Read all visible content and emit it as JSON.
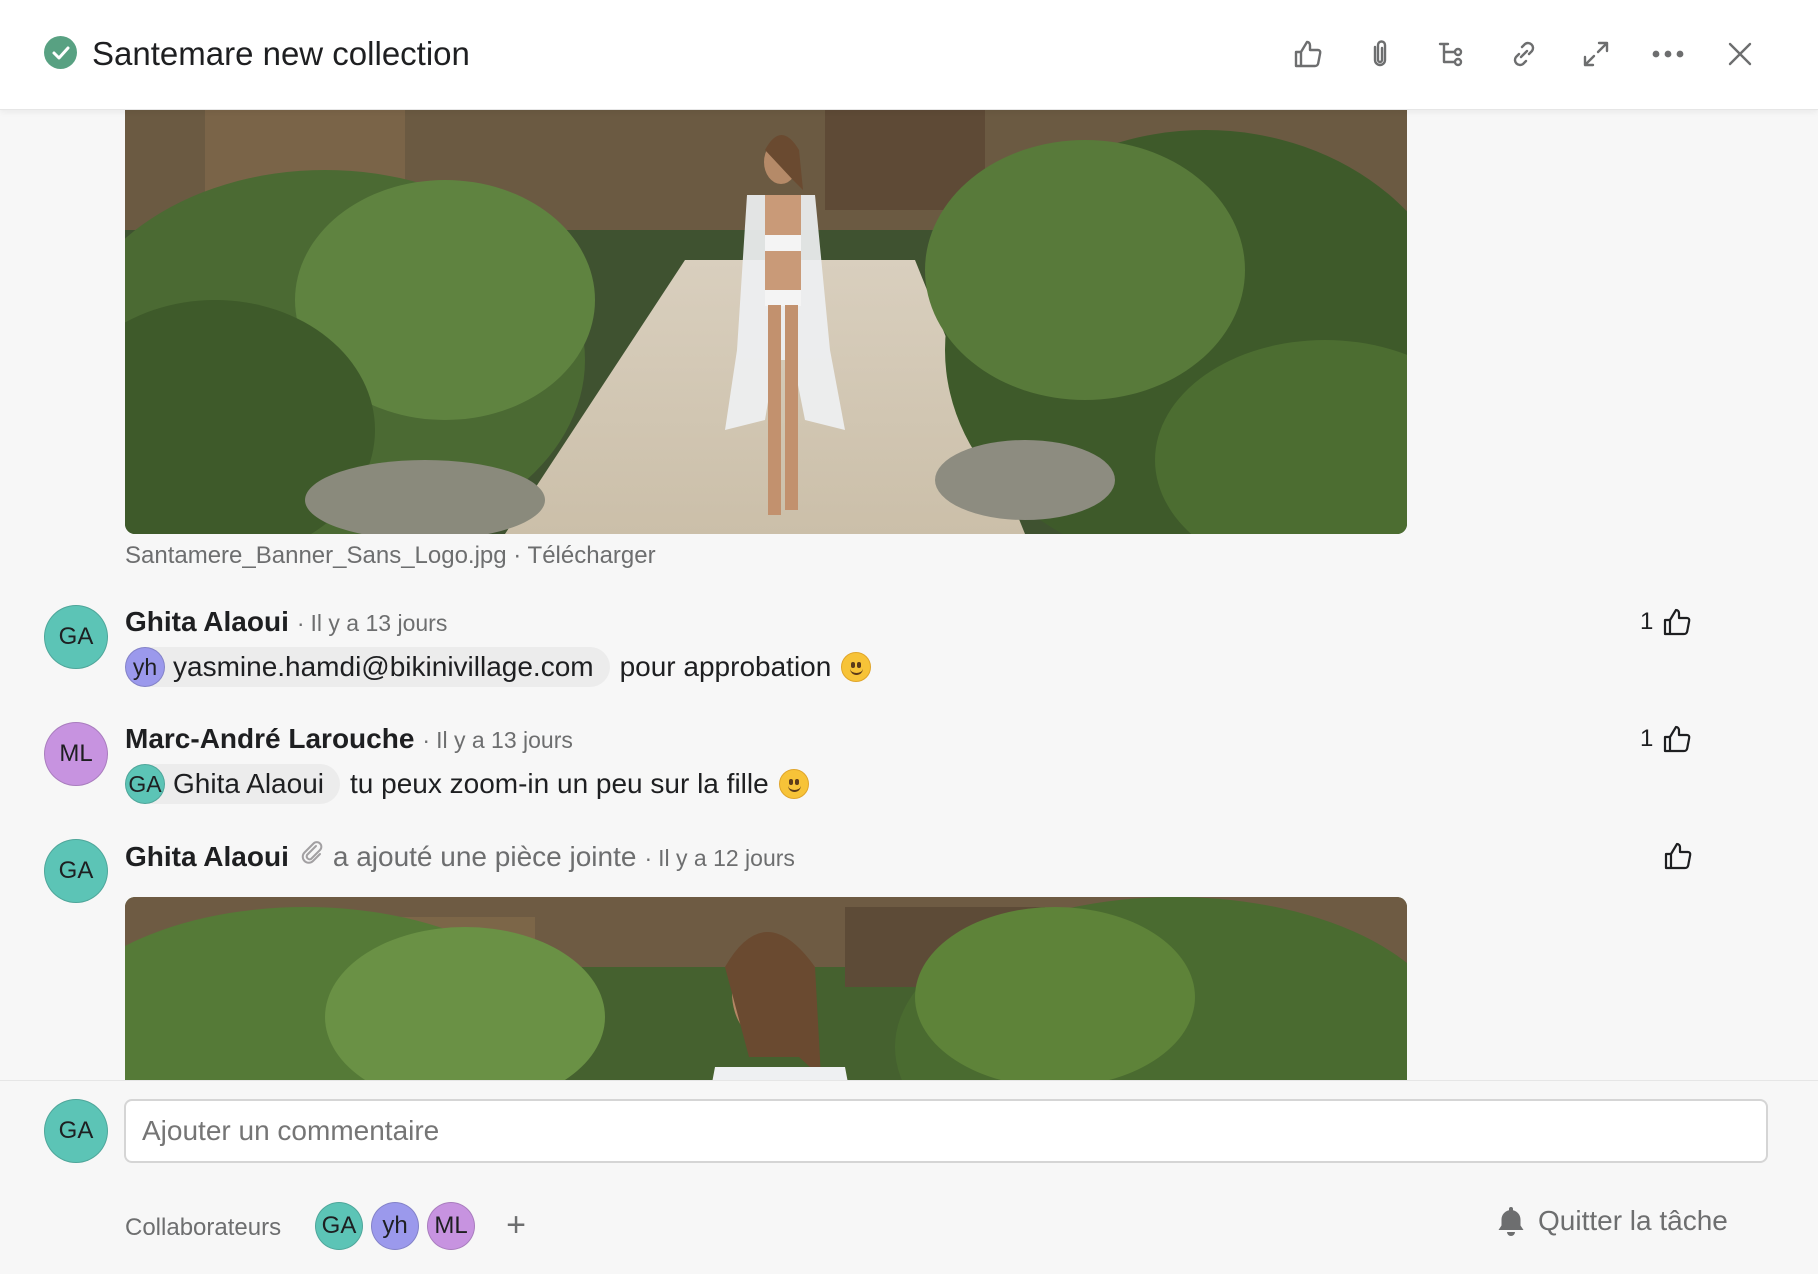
{
  "task": {
    "title": "Santemare new collection",
    "status": "completed"
  },
  "header_icons": [
    "thumbs-up-icon",
    "paperclip-icon",
    "subtask-icon",
    "link-icon",
    "expand-icon",
    "more-icon",
    "close-icon"
  ],
  "attachment_1": {
    "filename": "Santamere_Banner_Sans_Logo.jpg",
    "separator": "·",
    "download_label": "Télécharger"
  },
  "comments": [
    {
      "initials": "GA",
      "author": "Ghita Alaoui",
      "time": "Il y a 13 jours",
      "mention_initials": "yh",
      "mention": "yasmine.hamdi@bikinivillage.com",
      "text": "pour approbation",
      "likes": "1"
    },
    {
      "initials": "ML",
      "author": "Marc-André Larouche",
      "time": "Il y a 13 jours",
      "mention_initials": "GA",
      "mention": "Ghita Alaoui",
      "text": "tu peux zoom-in un peu sur la fille",
      "likes": "1"
    },
    {
      "initials": "GA",
      "author": "Ghita Alaoui",
      "action": "a ajouté une pièce jointe",
      "time": "Il y a 12 jours"
    }
  ],
  "composer": {
    "initials": "GA",
    "placeholder": "Ajouter un commentaire",
    "collaborators_label": "Collaborateurs",
    "collaborators": [
      "GA",
      "yh",
      "ML"
    ],
    "add_label": "+",
    "leave_label": "Quitter la tâche"
  },
  "colors": {
    "check": "#58a182",
    "avatar_teal": "#5cc4b6",
    "avatar_purple": "#c793e0",
    "avatar_blue": "#9b99ec"
  }
}
